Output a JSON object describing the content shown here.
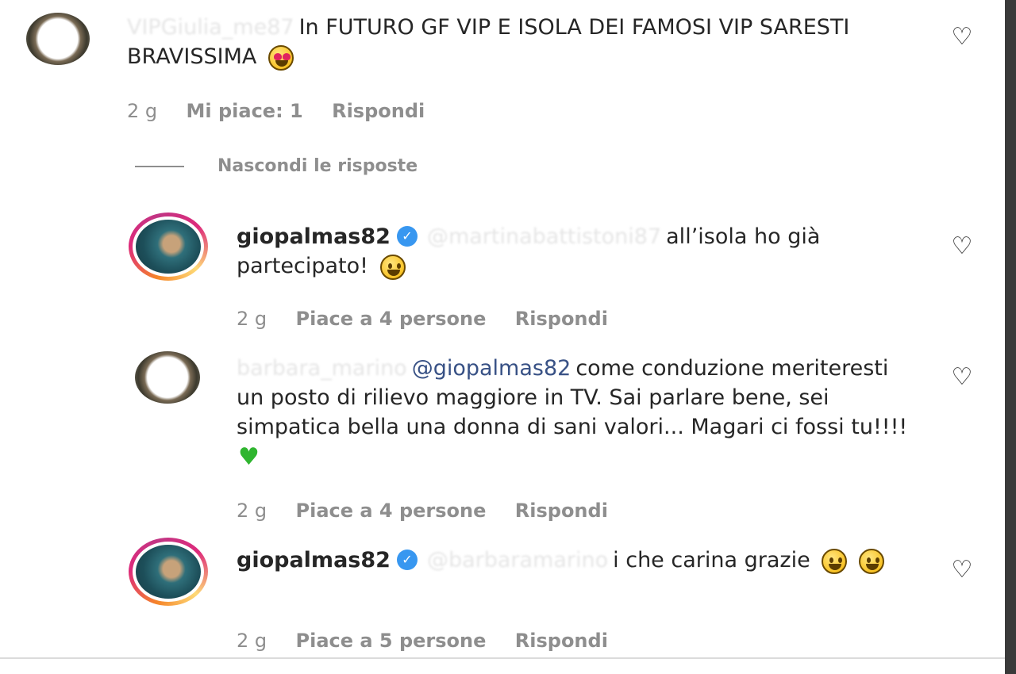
{
  "comments": [
    {
      "username_blurred": "\\",
      "text": "In FUTURO GF VIP E ISOLA DEI FAMOSI VIP SARESTI BRAVISSIMA",
      "time": "2 g",
      "likes": "Mi piace: 1",
      "reply": "Rispondi"
    },
    {
      "username": "giopalmas82",
      "mention_blurred": "@",
      "text": "all’isola ho già partecipato!",
      "time": "2 g",
      "likes": "Piace a 4 persone",
      "reply": "Rispondi"
    },
    {
      "mention": "@giopalmas82",
      "text": "come conduzione meriteresti un posto di rilievo maggiore in TV. Sai parlare bene, sei simpatica bella una donna di sani valori... Magari ci fossi tu!!!!",
      "time": "2 g",
      "likes": "Piace a 4 persone",
      "reply": "Rispondi"
    },
    {
      "username": "giopalmas82",
      "mention_blurred": "(",
      "text": "i che carina grazie",
      "time": "2 g",
      "likes": "Piace a 5 persone",
      "reply": "Rispondi"
    }
  ],
  "hide_replies": "Nascondi le risposte",
  "icons": {
    "like": "heart-outline-icon",
    "verified": "verified-badge-icon"
  }
}
